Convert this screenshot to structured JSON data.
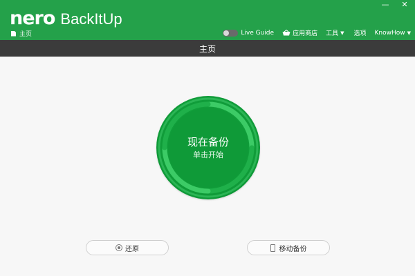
{
  "app": {
    "brand": "nero",
    "product": "BackItUp"
  },
  "breadcrumb": {
    "label": "主页",
    "icon": "document-icon"
  },
  "window_controls": {
    "minimize": "—",
    "close": "✕"
  },
  "toolbar": {
    "live_guide": "Live Guide",
    "app_store": "应用商店",
    "tools": "工具",
    "options": "选项",
    "knowhow": "KnowHow"
  },
  "page": {
    "title": "主页"
  },
  "backup_button": {
    "title": "现在备份",
    "subtitle": "单击开始"
  },
  "actions": {
    "restore": "还原",
    "mobile_backup": "移动备份"
  },
  "colors": {
    "header": "#24a14a",
    "titlebar": "#3b3b3b",
    "circle": "#0f9a38",
    "ring": "#38c35f",
    "background": "#f7f7f7"
  }
}
